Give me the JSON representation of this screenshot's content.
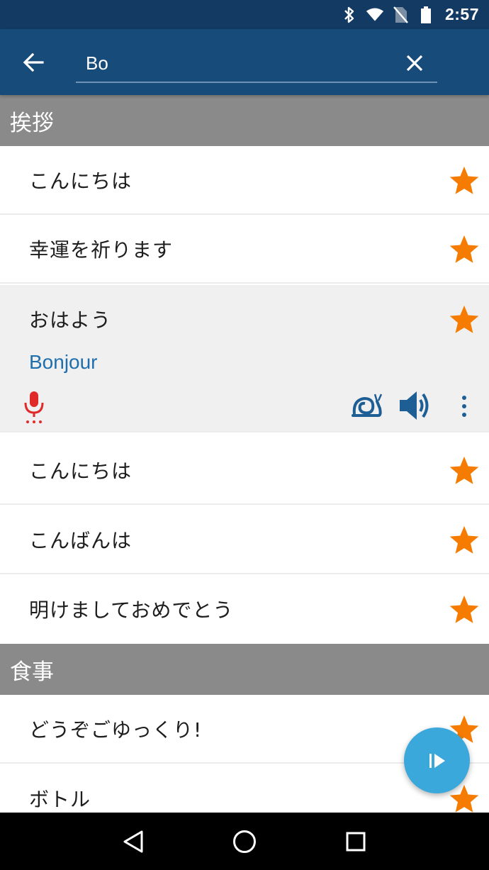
{
  "status_bar": {
    "time": "2:57",
    "icons": [
      "bluetooth-icon",
      "wifi-icon",
      "no-sim-icon",
      "battery-icon"
    ]
  },
  "search": {
    "value": "Bo",
    "back_icon": "arrow-back-icon",
    "clear_icon": "close-icon"
  },
  "sections": [
    {
      "title": "挨拶",
      "items": [
        {
          "phrase": "こんにちは",
          "starred": true
        },
        {
          "phrase": "幸運を祈ります",
          "starred": true
        },
        {
          "phrase": "おはよう",
          "translation": "Bonjour",
          "starred": true,
          "expanded": true
        },
        {
          "phrase": "こんにちは",
          "starred": true
        },
        {
          "phrase": "こんばんは",
          "starred": true
        },
        {
          "phrase": "明けましておめでとう",
          "starred": true
        }
      ]
    },
    {
      "title": "食事",
      "items": [
        {
          "phrase": "どうぞごゆっくり!",
          "starred": true
        },
        {
          "phrase": "ボトル",
          "starred": true
        }
      ]
    }
  ],
  "expanded_actions": [
    "microphone-icon",
    "slow-playback-snail-icon",
    "speaker-icon",
    "more-vertical-icon"
  ],
  "fab": {
    "icon": "play-icon"
  },
  "nav": [
    "back-triangle-icon",
    "home-circle-icon",
    "recents-square-icon"
  ],
  "colors": {
    "status_bar": "#123a62",
    "app_bar": "#174b7a",
    "section_header": "#8a8a8a",
    "star": "#f57c00",
    "translation": "#1f6fae",
    "mic": "#e02a2a",
    "fab": "#3ba8dc"
  }
}
